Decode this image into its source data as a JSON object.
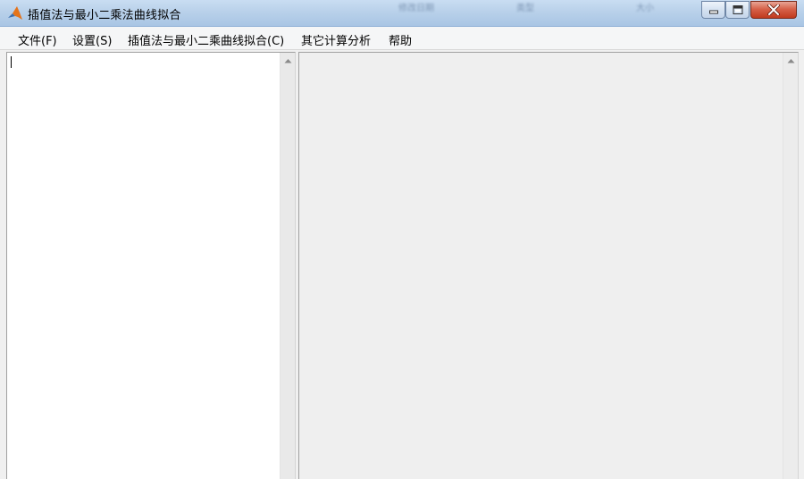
{
  "window": {
    "title": "插值法与最小二乘法曲线拟合",
    "icon": "matlab-icon",
    "background_hints": [
      "修改日期",
      "类型",
      "大小"
    ],
    "controls": {
      "minimize": "minimize-icon",
      "maximize": "maximize-icon",
      "close": "close-icon"
    },
    "colors": {
      "title_bar": "#b9d1ea",
      "close_button": "#c94a30"
    }
  },
  "menu": {
    "items": [
      {
        "label": "文件(F)",
        "mnemonic": "F"
      },
      {
        "label": "设置(S)",
        "mnemonic": "S"
      },
      {
        "label": "插值法与最小二乘曲线拟合(C)",
        "mnemonic": "C"
      },
      {
        "label": "其它计算分析"
      },
      {
        "label": "帮助"
      }
    ]
  },
  "left_editor": {
    "value": ""
  }
}
